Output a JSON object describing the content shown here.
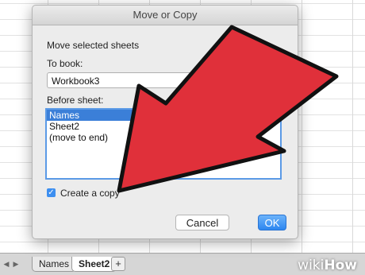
{
  "dialog": {
    "title": "Move or Copy",
    "heading": "Move selected sheets",
    "to_book_label": "To book:",
    "to_book_value": "Workbook3",
    "before_sheet_label": "Before sheet:",
    "before_sheet_items": [
      "Names",
      "Sheet2",
      "(move to end)"
    ],
    "selected_item": "Names",
    "create_copy_label": "Create a copy",
    "create_copy_checked": true,
    "cancel_label": "Cancel",
    "ok_label": "OK"
  },
  "tabs": {
    "items": [
      "Names",
      "Sheet2"
    ],
    "active": "Sheet2",
    "add_label": "+"
  },
  "watermark": {
    "prefix": "wiki",
    "suffix": "How"
  },
  "colors": {
    "arrow": "#e0303a",
    "accent": "#3b7fd8",
    "ok_button": "#2d86f0"
  }
}
